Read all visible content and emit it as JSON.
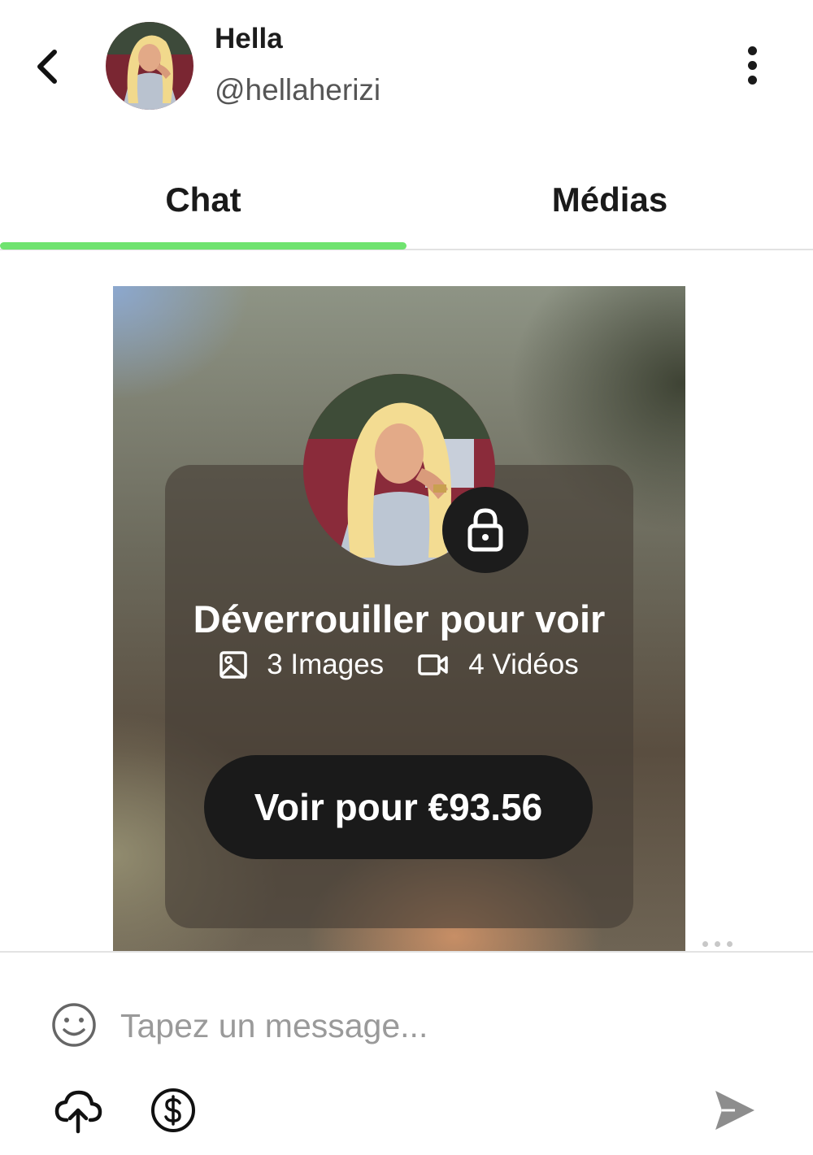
{
  "header": {
    "name": "Hella",
    "handle": "@hellaherizi"
  },
  "tabs": [
    {
      "label": "Chat",
      "active": true
    },
    {
      "label": "Médias",
      "active": false
    }
  ],
  "media_card": {
    "title": "Déverrouiller pour voir",
    "images_label": "3 Images",
    "videos_label": "4 Vidéos",
    "button_label": "Voir pour €93.56"
  },
  "composer": {
    "placeholder": "Tapez un message..."
  },
  "icons": [
    "back-arrow-icon",
    "more-vertical-icon",
    "lock-icon",
    "image-icon",
    "video-icon",
    "emoji-icon",
    "upload-cloud-icon",
    "dollar-icon",
    "send-icon"
  ],
  "colors": {
    "accent": "#6fe36f",
    "button_dark": "#1a1a1a"
  }
}
